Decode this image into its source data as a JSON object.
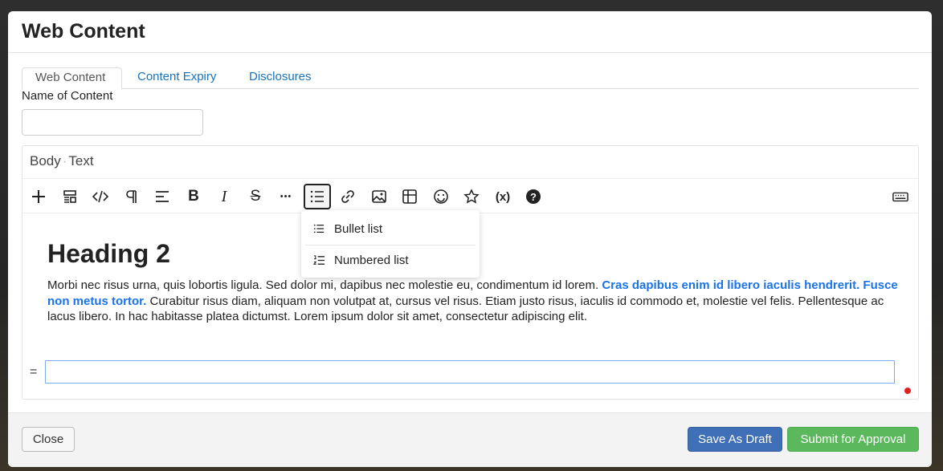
{
  "modal": {
    "title": "Web Content"
  },
  "tabs": [
    {
      "label": "Web Content",
      "active": true
    },
    {
      "label": "Content Expiry",
      "active": false
    },
    {
      "label": "Disclosures",
      "active": false
    }
  ],
  "name_field": {
    "label": "Name of Content",
    "value": "",
    "placeholder": ""
  },
  "editor": {
    "label_part1": "Body",
    "label_part2": "Text",
    "toolbar": [
      {
        "icon": "plus-icon"
      },
      {
        "icon": "block-style-icon"
      },
      {
        "icon": "code-icon"
      },
      {
        "icon": "paragraph-icon"
      },
      {
        "icon": "align-left-icon"
      },
      {
        "icon": "bold-icon",
        "glyph": "B"
      },
      {
        "icon": "italic-icon",
        "glyph": "I"
      },
      {
        "icon": "strikethrough-icon",
        "glyph": "S"
      },
      {
        "icon": "more-icon",
        "glyph": "•••"
      },
      {
        "icon": "list-icon",
        "active": true
      },
      {
        "icon": "link-icon"
      },
      {
        "icon": "image-icon"
      },
      {
        "icon": "table-icon"
      },
      {
        "icon": "emoji-icon"
      },
      {
        "icon": "star-icon"
      },
      {
        "icon": "variable-icon",
        "glyph": "(x)"
      },
      {
        "icon": "help-icon",
        "glyph": "?"
      },
      {
        "icon": "keyboard-icon"
      }
    ],
    "list_menu": {
      "bullet": "Bullet list",
      "numbered": "Numbered list"
    },
    "heading": "Heading 2",
    "paragraph_1": "Morbi nec risus urna, quis lobortis ligula. Sed dolor mi, dapibus nec molestie eu, condimentum id lorem. ",
    "paragraph_link": "Cras dapibus enim id libero iaculis hendrerit. Fusce non metus tortor.",
    "paragraph_2": " Curabitur risus diam, aliquam non volutpat at, cursus vel risus. Etiam justo risus, iaculis id commodo et, molestie vel felis. Pellentesque ac lacus libero. In hac habitasse platea dictumst. Lorem ipsum dolor sit amet, consectetur adipiscing elit.",
    "drag_handle": "="
  },
  "footer": {
    "close": "Close",
    "save_draft": "Save As Draft",
    "submit": "Submit for Approval"
  },
  "colors": {
    "link": "#1a73e8",
    "draft_button": "#3f6fb6",
    "submit_button": "#5cb85c"
  }
}
